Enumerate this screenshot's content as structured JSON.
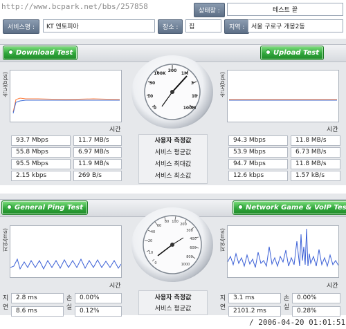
{
  "top": {
    "url": "http://www.bcpark.net/bbs/257858",
    "status_label": "상태창 :",
    "status_value": "테스트 끝",
    "service_label": "서비스명 :",
    "service_value": "KT 엔토피아",
    "place_label": "장소 :",
    "place_value": "집",
    "region_label": "지역 :",
    "region_value": "서울 구로구 개봉2동"
  },
  "speed": {
    "download_button": "Download Test",
    "upload_button": "Upload Test",
    "ylabel": "속도(bps)",
    "xlabel": "시간",
    "center_title": "사용자 측정값",
    "center_rows": [
      "서비스 평균값",
      "서비스 최대값",
      "서비스 최소값"
    ],
    "download_rows": [
      [
        "93.7 Mbps",
        "11.7 MB/s"
      ],
      [
        "55.8 Mbps",
        "6.97 MB/s"
      ],
      [
        "95.5 Mbps",
        "11.9 MB/s"
      ],
      [
        "2.15 kbps",
        "269 B/s"
      ]
    ],
    "upload_rows": [
      [
        "94.3 Mbps",
        "11.8 MB/s"
      ],
      [
        "53.9 Mbps",
        "6.73 MB/s"
      ],
      [
        "94.7 Mbps",
        "11.8 MB/s"
      ],
      [
        "12.6 kbps",
        "1.57 kB/s"
      ]
    ],
    "gauge_labels": [
      "0",
      "10",
      "30",
      "100K",
      "300",
      "1M",
      "3",
      "10",
      "100M"
    ]
  },
  "ping": {
    "ping_button": "General Ping Test",
    "voip_button": "Network Game & VoIP Test",
    "ylabel": "지연(ms)",
    "xlabel": "시간",
    "center_title": "사용자 측정값",
    "center_rows": [
      "서비스 평균값"
    ],
    "left_side": [
      "지연",
      "손실"
    ],
    "left_side_labels2": [
      "지연",
      "손실"
    ],
    "ping_rows": [
      [
        "2.8 ms",
        "0.00%"
      ],
      [
        "8.6 ms",
        "0.12%"
      ]
    ],
    "voip_rows": [
      [
        "3.1 ms",
        "0.00%"
      ],
      [
        "2101.2 ms",
        "0.28%"
      ]
    ],
    "gauge_labels": [
      "0",
      "10",
      "20",
      "40",
      "60",
      "80",
      "100",
      "200",
      "300",
      "400",
      "600",
      "800",
      "1000"
    ]
  },
  "timestamp": "/ 2006-04-20 01:01:51"
}
